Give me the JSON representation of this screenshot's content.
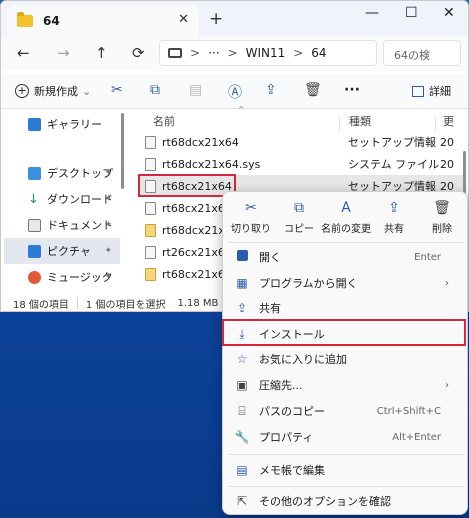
{
  "window": {
    "tab_title": "64",
    "new_tab": "+",
    "controls": {
      "minimize": "—",
      "maximize": "☐",
      "close": "✕"
    }
  },
  "nav": {
    "back": "←",
    "forward": "→",
    "up": "↑",
    "refresh": "⟳",
    "address": {
      "separator": ">",
      "more": "···",
      "path": [
        "WIN11",
        "64"
      ]
    },
    "search_placeholder": "64の検"
  },
  "toolbar": {
    "new_label": "新規作成",
    "new_caret": "⌄",
    "more": "···",
    "details_label": "詳細"
  },
  "sidebar": {
    "items": [
      {
        "label": "ギャラリー"
      },
      {
        "label": "デスクトップ"
      },
      {
        "label": "ダウンロード"
      },
      {
        "label": "ドキュメント"
      },
      {
        "label": "ピクチャ"
      },
      {
        "label": "ミュージック"
      }
    ],
    "pin": "📌"
  },
  "filelist": {
    "headers": {
      "name": "名前",
      "type": "種類",
      "date": "更"
    },
    "sort_indicator": "^",
    "rows": [
      {
        "name": "rt68dcx21x64",
        "type": "セットアップ情報",
        "date": "20"
      },
      {
        "name": "rt68dcx21x64.sys",
        "type": "システム ファイル",
        "date": "20"
      },
      {
        "name": "rt68cx21x64",
        "type": "セットアップ情報",
        "date": "20"
      },
      {
        "name": "rt68cx21x64.sys",
        "type": "",
        "date": ""
      },
      {
        "name": "rt68dcx21x64",
        "type": "",
        "date": ""
      },
      {
        "name": "rt26cx21x64.sys",
        "type": "",
        "date": ""
      },
      {
        "name": "rt68cx21x64",
        "type": "",
        "date": ""
      }
    ]
  },
  "status": {
    "count": "18 個の項目",
    "selected": "1 個の項目を選択",
    "size": "1.18 MB"
  },
  "context_menu": {
    "quick_actions": [
      {
        "label": "切り取り",
        "icon": "✂"
      },
      {
        "label": "コピー",
        "icon": "⧉"
      },
      {
        "label": "名前の変更",
        "icon": "A"
      },
      {
        "label": "共有",
        "icon": "⇪"
      },
      {
        "label": "削除",
        "icon": "🗑"
      }
    ],
    "items": [
      {
        "label": "開く",
        "shortcut": "Enter"
      },
      {
        "label": "プログラムから開く",
        "arrow": "›"
      },
      {
        "label": "共有"
      },
      {
        "label": "インストール"
      },
      {
        "label": "お気に入りに追加"
      },
      {
        "label": "圧縮先...",
        "arrow": "›"
      },
      {
        "label": "パスのコピー",
        "shortcut": "Ctrl+Shift+C"
      },
      {
        "label": "プロパティ",
        "shortcut": "Alt+Enter"
      },
      {
        "label": "メモ帳で編集"
      },
      {
        "label": "その他のオプションを確認"
      }
    ]
  },
  "colors": {
    "accent": "#2b5cae",
    "highlight": "#d7263d",
    "desktop": "#1a5fb4"
  }
}
